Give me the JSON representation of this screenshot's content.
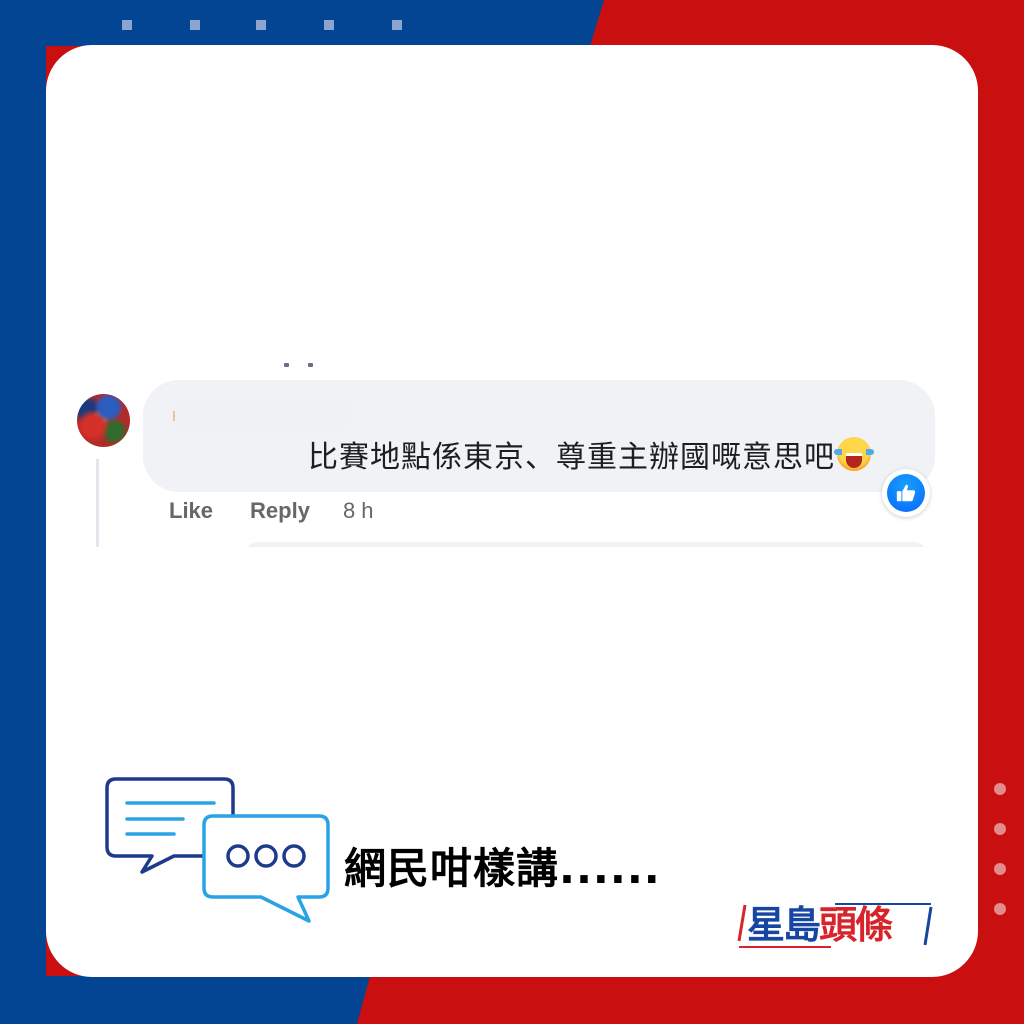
{
  "colors": {
    "brand_blue": "#034593",
    "brand_red": "#c90f10",
    "bubble_bg": "#f0f2f5",
    "meta_text": "#65676b",
    "like_blue": "#0866ff",
    "icon_dark_blue": "#1e3a8a",
    "icon_light_blue": "#29a3e5"
  },
  "comment": {
    "author_name": "",
    "text": "比賽地點係東京、尊重主辦國嘅意思吧",
    "emoji": "laughing-with-tears-emoji",
    "reaction": "like",
    "actions": {
      "like_label": "Like",
      "reply_label": "Reply",
      "timestamp": "8 h"
    }
  },
  "headline": {
    "text": "網民咁樣講......",
    "icon": "chat-bubbles-icon"
  },
  "logo": {
    "part1": "星島",
    "part2": "頭條"
  }
}
